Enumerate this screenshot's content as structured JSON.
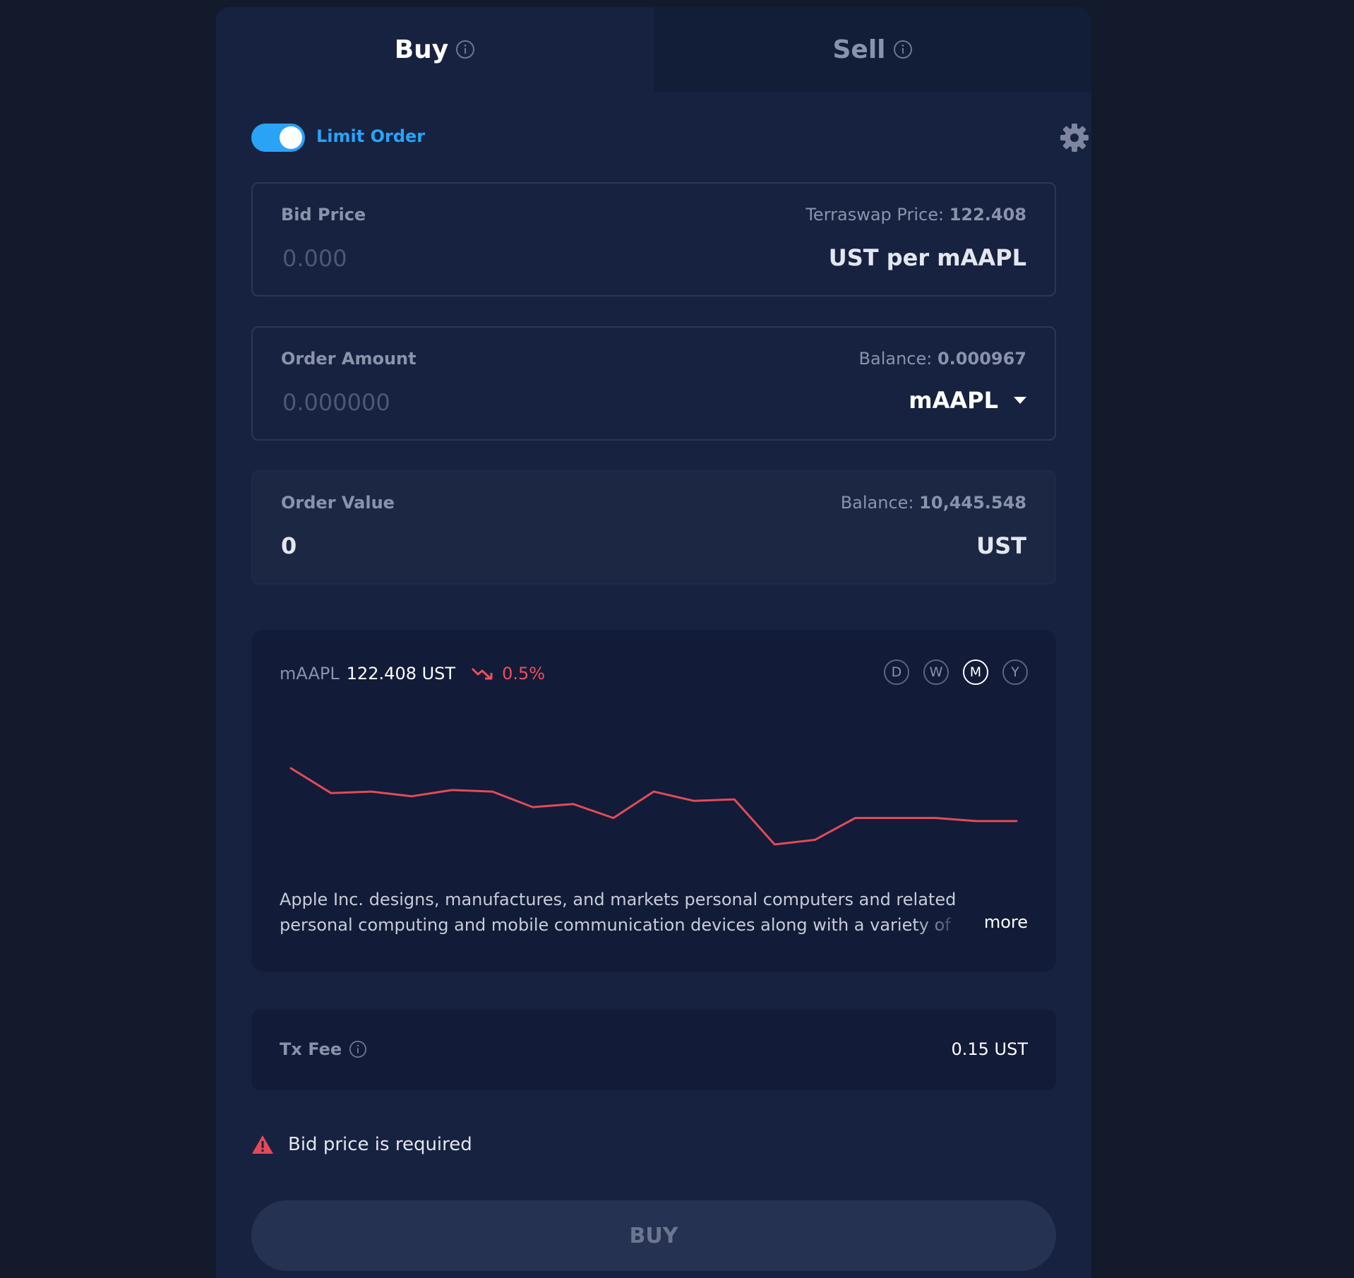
{
  "tabs": {
    "buy_label": "Buy",
    "sell_label": "Sell",
    "active": "Buy"
  },
  "limit_order": {
    "label": "Limit Order",
    "enabled": true
  },
  "bid_price": {
    "label": "Bid Price",
    "meta_label": "Terraswap Price:",
    "meta_value": "122.408",
    "placeholder": "0.000",
    "unit": "UST per mAAPL"
  },
  "order_amount": {
    "label": "Order Amount",
    "meta_label": "Balance:",
    "meta_value": "0.000967",
    "placeholder": "0.000000",
    "token": "mAAPL"
  },
  "order_value": {
    "label": "Order Value",
    "meta_label": "Balance:",
    "meta_value": "10,445.548",
    "value": "0",
    "unit": "UST"
  },
  "chart_card": {
    "symbol": "mAAPL",
    "price": "122.408 UST",
    "change": "0.5%",
    "change_direction": "down",
    "periods": [
      "D",
      "W",
      "M",
      "Y"
    ],
    "active_period": "M",
    "line_color": "#e04b5a",
    "description": "Apple Inc. designs, manufactures, and markets personal computers and related personal computing and mobile communication devices along with a variety of",
    "more_label": "more"
  },
  "chart_data": {
    "type": "line",
    "title": "",
    "xlabel": "",
    "ylabel": "",
    "grid": false,
    "series": [
      {
        "values": [
          126.1,
          124.5,
          124.6,
          124.3,
          124.7,
          124.6,
          123.6,
          123.8,
          122.9,
          124.6,
          124.0,
          124.1,
          121.2,
          121.5,
          122.9,
          122.9,
          122.9,
          122.7,
          122.7
        ]
      }
    ]
  },
  "tx_fee": {
    "label": "Tx Fee",
    "value": "0.15 UST"
  },
  "warning": {
    "text": "Bid price is required",
    "color": "#e04b5a"
  },
  "submit": {
    "label": "BUY"
  },
  "colors": {
    "accent": "#2aa3f7",
    "negative": "#f04e5e",
    "background": "#121a2b",
    "card": "#172240"
  }
}
